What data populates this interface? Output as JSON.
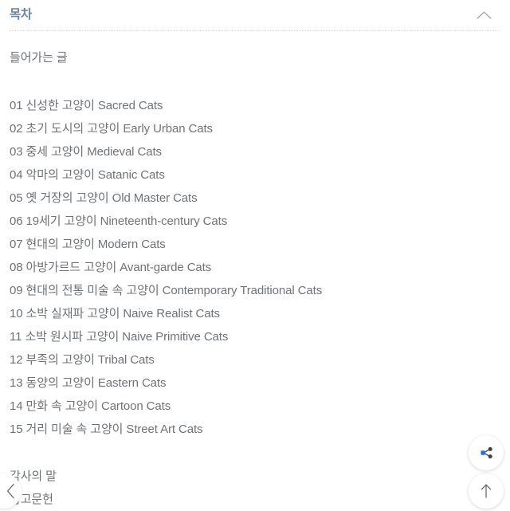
{
  "panel": {
    "title": "목차",
    "collapse_icon": "chevron-up-icon"
  },
  "toc": {
    "lead": "들어가는 글",
    "entries": [
      "01 신성한 고양이 Sacred Cats",
      "02 초기 도시의 고양이 Early Urban Cats",
      "03 중세 고양이 Medieval Cats",
      "04 악마의 고양이 Satanic Cats",
      "05 옛 거장의 고양이 Old Master Cats",
      "06 19세기 고양이 Nineteenth-century Cats",
      "07 현대의 고양이 Modern Cats",
      "08 아방가르드 고양이 Avant-garde Cats",
      "09 현대의 전통 미술 속 고양이 Contemporary Traditional Cats",
      "10 소박 실재파 고양이 Naive Realist Cats",
      "11 소박 원시파 고양이 Naive Primitive Cats",
      "12 부족의 고양이 Tribal Cats",
      "13 동양의 고양이 Eastern Cats",
      "14 만화 속 고양이 Cartoon Cats",
      "15 거리 미술 속 고양이 Street Art Cats"
    ],
    "tail": [
      "감사의 말",
      "참고문헌"
    ]
  },
  "actions": {
    "share_label": "share-icon",
    "scroll_top_label": "arrow-up-icon",
    "back_label": "chevron-left-icon"
  },
  "colors": {
    "title": "#6b86a8",
    "text": "#6f7377",
    "divider": "#dcdfe3",
    "share_accent": "#1a73e8",
    "share_node": "#3c4043",
    "background": "#ffffff"
  }
}
